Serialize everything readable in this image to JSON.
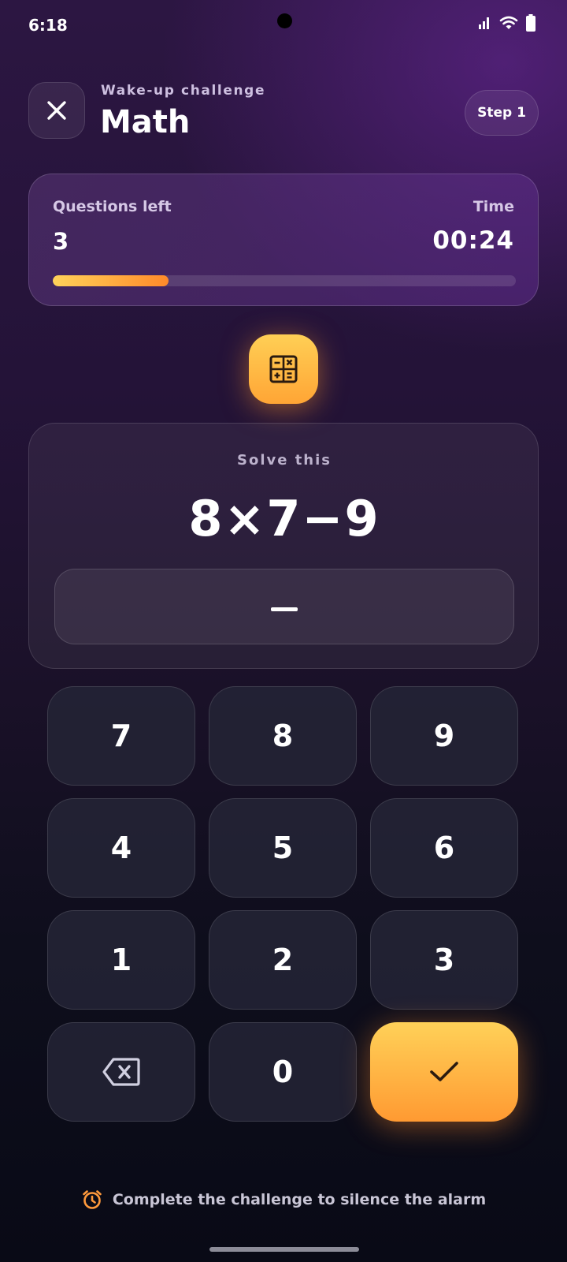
{
  "status_bar": {
    "time": "6:18"
  },
  "header": {
    "subtitle": "Wake-up challenge",
    "title": "Math",
    "step": "Step 1"
  },
  "progress": {
    "questions_label": "Questions left",
    "questions_value": "3",
    "time_label": "Time",
    "time_value": "00:24",
    "fill_fraction": 0.25
  },
  "question": {
    "label": "Solve this",
    "expression": "8×7−9"
  },
  "keypad": {
    "keys": [
      "7",
      "8",
      "9",
      "4",
      "5",
      "6",
      "1",
      "2",
      "3"
    ],
    "zero": "0"
  },
  "footer": {
    "hint": "Complete the challenge to silence the alarm"
  },
  "colors": {
    "accent_start": "#ffd25a",
    "accent_end": "#ff8a2a"
  },
  "icons": {
    "close": "close-icon",
    "calculator": "calculator-icon",
    "backspace": "backspace-icon",
    "confirm": "checkmark-icon",
    "alarm": "alarm-clock-icon"
  }
}
